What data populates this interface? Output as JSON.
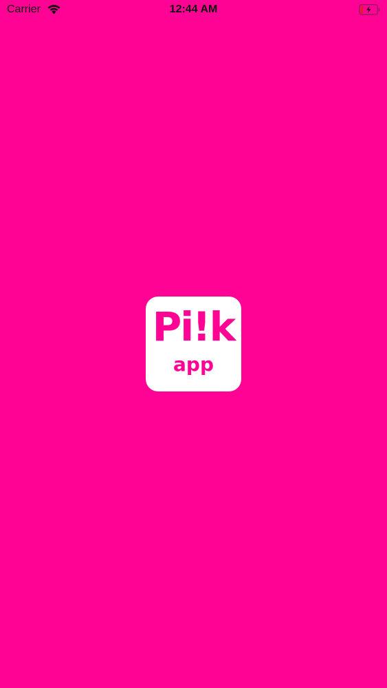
{
  "status_bar": {
    "carrier": "Carrier",
    "time": "12:44 AM",
    "wifi_icon": "wifi-icon",
    "battery_icon": "battery-charging-icon"
  },
  "splash": {
    "background_color": "#FF0394",
    "logo": {
      "word": "Pi!k",
      "sub": "app",
      "icon": "pilk-app-logo"
    }
  }
}
